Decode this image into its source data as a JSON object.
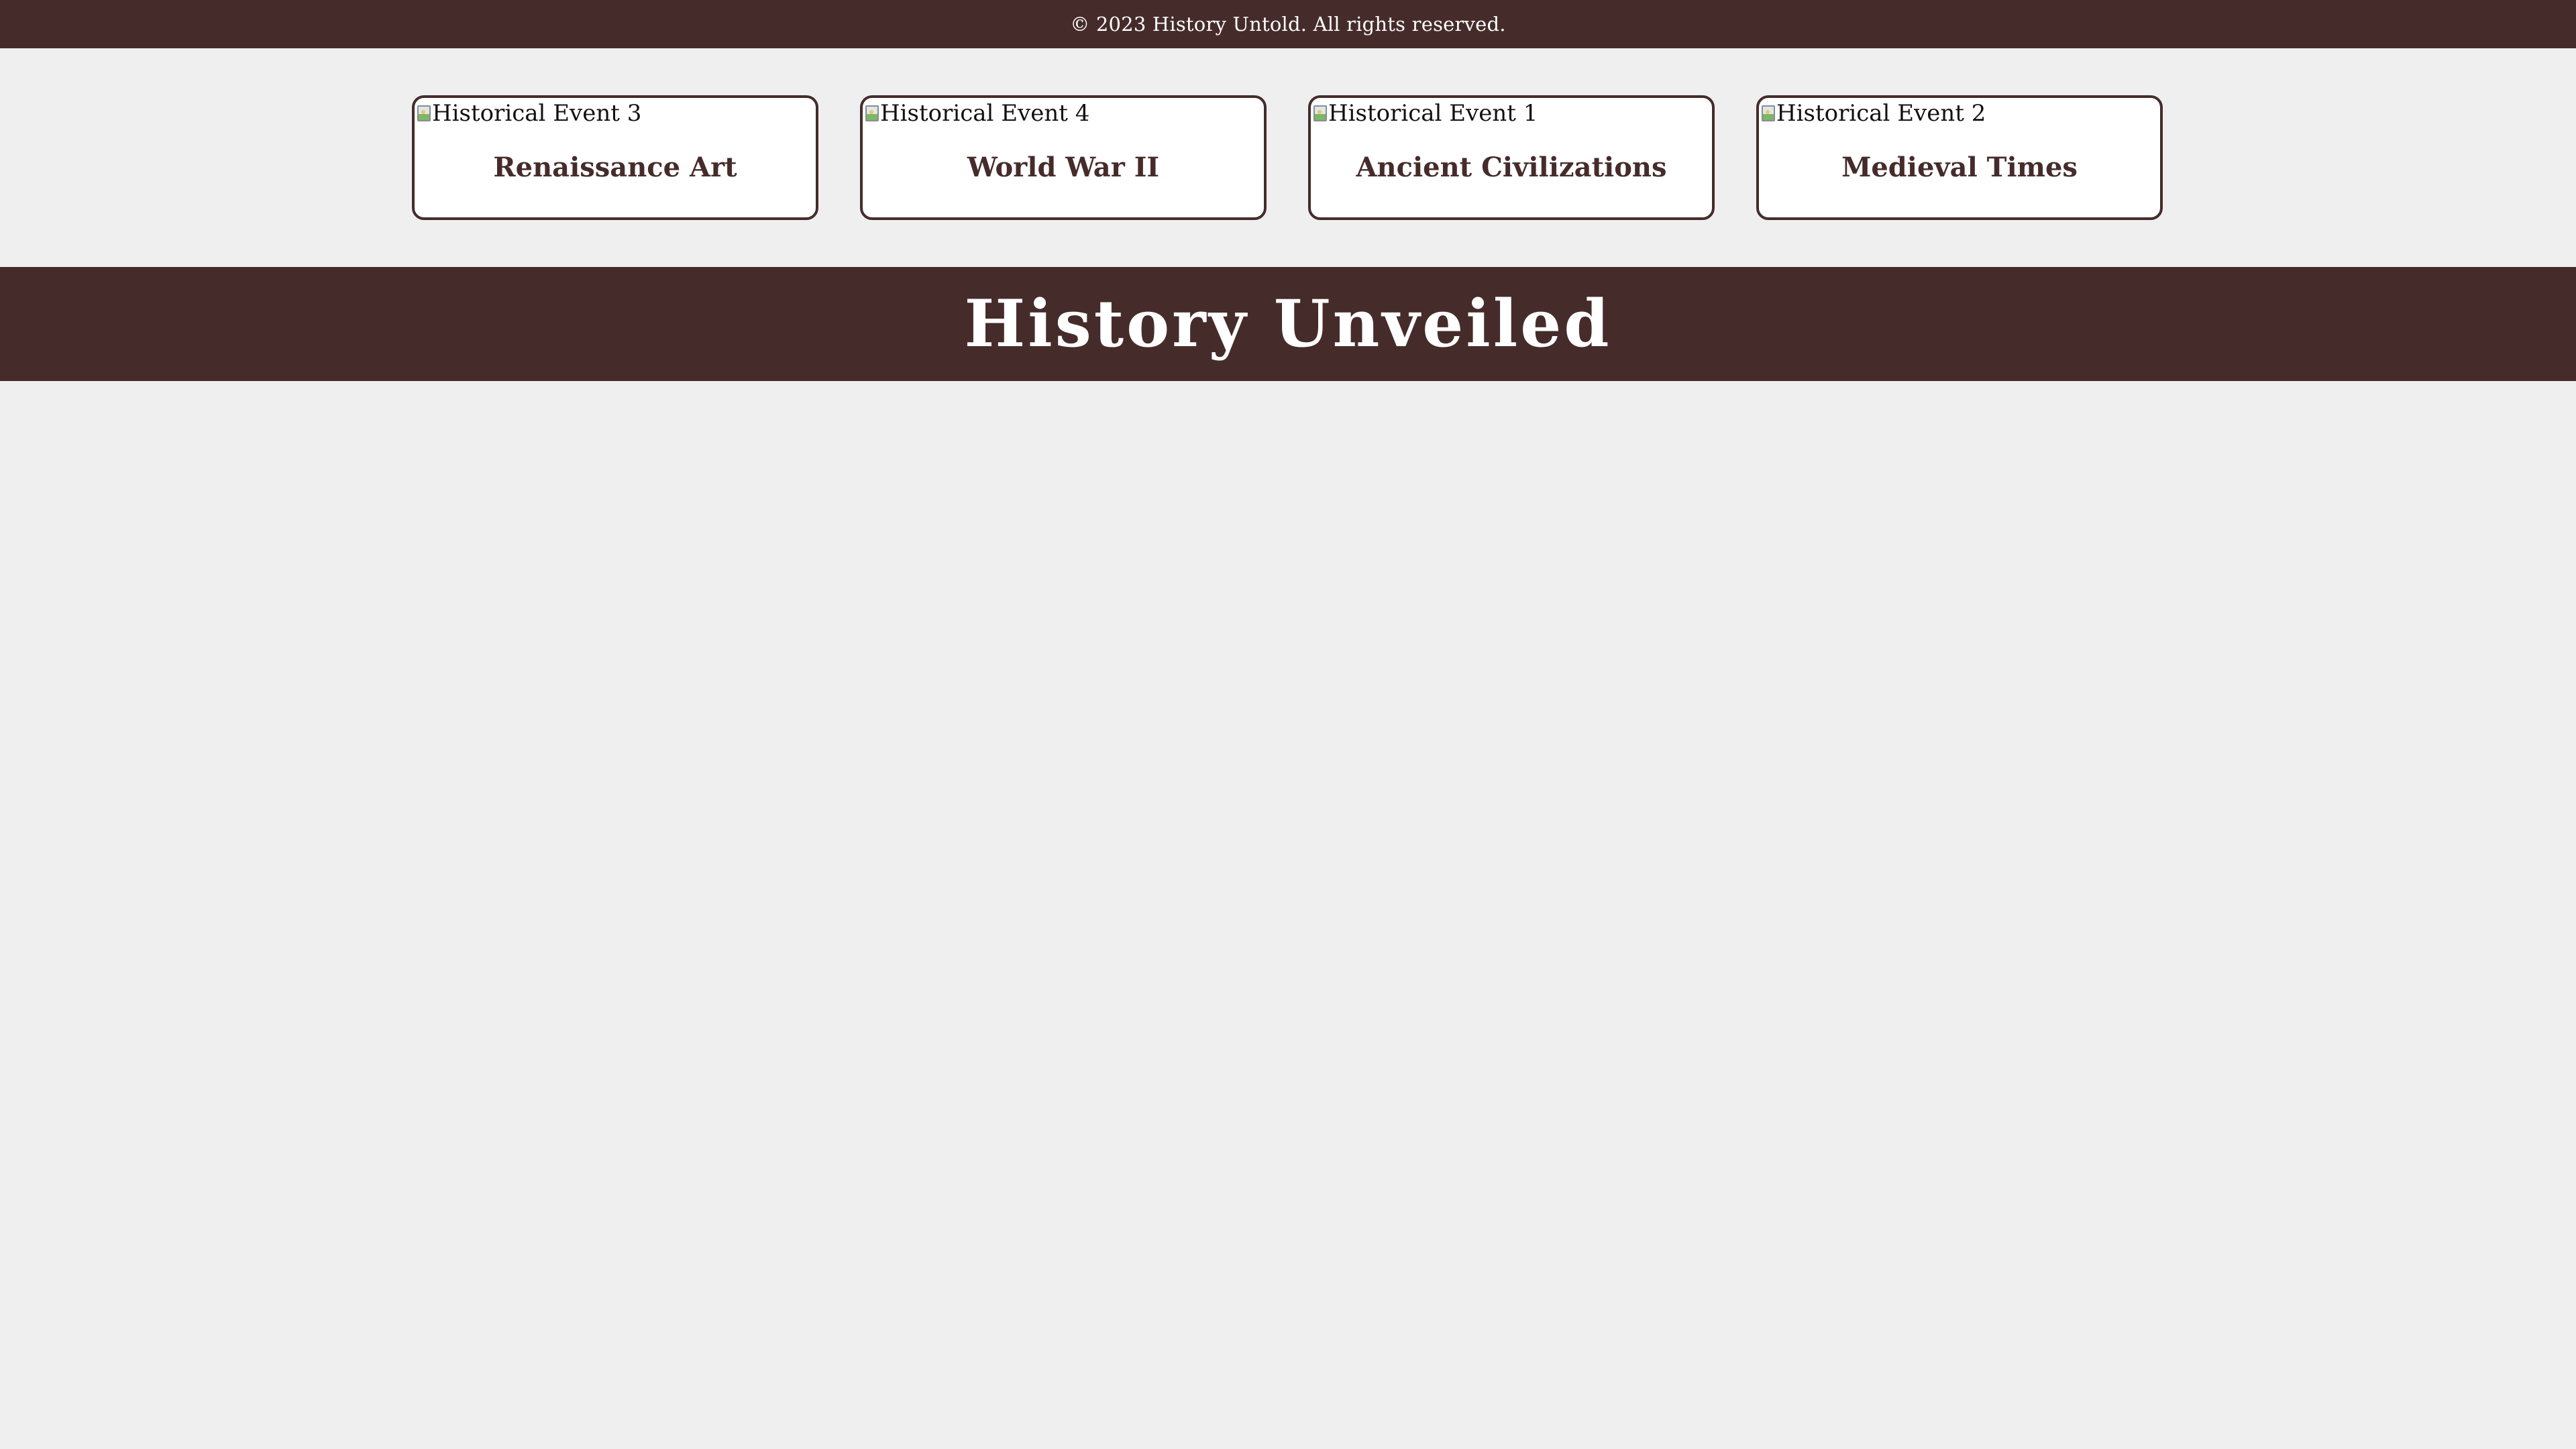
{
  "footer": {
    "copyright": "© 2023 History Untold. All rights reserved."
  },
  "cards": [
    {
      "image_alt": "Historical Event 3",
      "title": "Renaissance Art",
      "icon": "broken-image-icon"
    },
    {
      "image_alt": "Historical Event 4",
      "title": "World War II",
      "icon": "broken-image-icon"
    },
    {
      "image_alt": "Historical Event 1",
      "title": "Ancient Civilizations",
      "icon": "broken-image-icon"
    },
    {
      "image_alt": "Historical Event 2",
      "title": "Medieval Times",
      "icon": "broken-image-icon"
    }
  ],
  "header": {
    "site_title": "History Unveiled"
  },
  "colors": {
    "primary_dark": "#452c2a",
    "page_background": "#efefef",
    "card_background": "#ffffff",
    "text_light": "#ffffff"
  }
}
